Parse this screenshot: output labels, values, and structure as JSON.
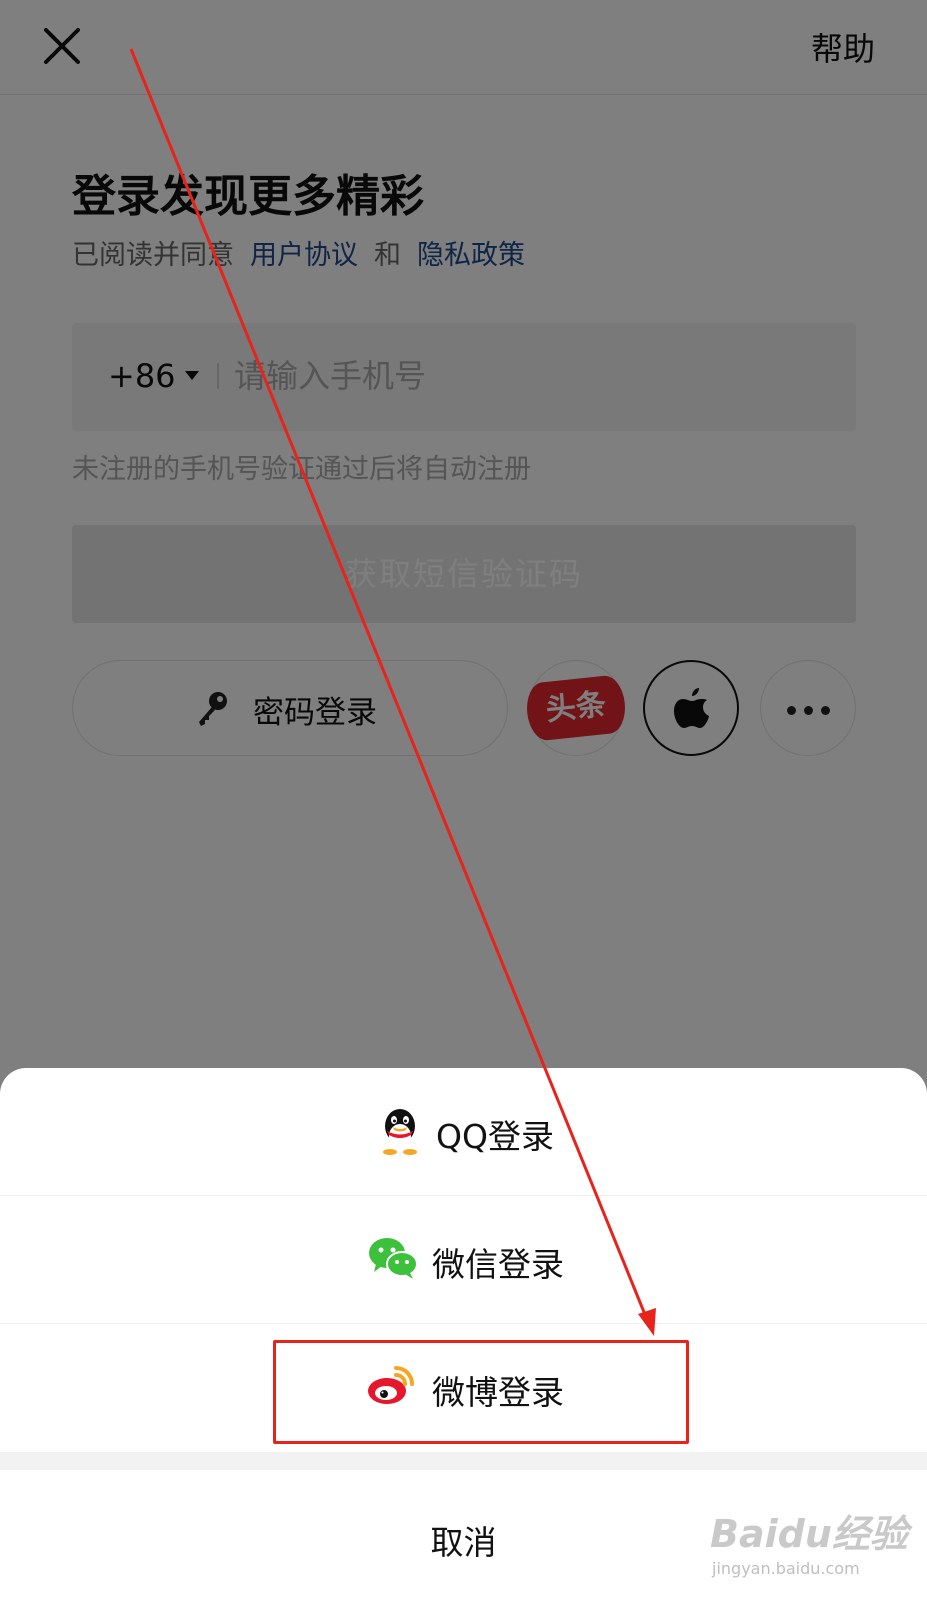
{
  "header": {
    "help_label": "帮助"
  },
  "login": {
    "title": "登录发现更多精彩",
    "agreement_prefix": "已阅读并同意",
    "user_agreement": "用户协议",
    "and": "和",
    "privacy_policy": "隐私政策",
    "country_code": "+86",
    "phone_placeholder": "请输入手机号",
    "hint": "未注册的手机号验证通过后将自动注册",
    "sms_button": "获取短信验证码",
    "password_login": "密码登录",
    "toutiao_badge": "头条"
  },
  "sheet": {
    "items": [
      {
        "label": "QQ登录",
        "icon": "qq-icon"
      },
      {
        "label": "微信登录",
        "icon": "wechat-icon"
      },
      {
        "label": "微博登录",
        "icon": "weibo-icon"
      }
    ],
    "cancel": "取消"
  },
  "watermark": {
    "logo": "Baidu经验",
    "url": "jingyan.baidu.com"
  },
  "colors": {
    "link_blue": "#1f4a8f",
    "annotation_red": "#e8231b",
    "toutiao_red": "#e3262e",
    "wechat_green": "#3dc13c",
    "weibo_red": "#e6162d",
    "weibo_orange": "#f5a623"
  }
}
